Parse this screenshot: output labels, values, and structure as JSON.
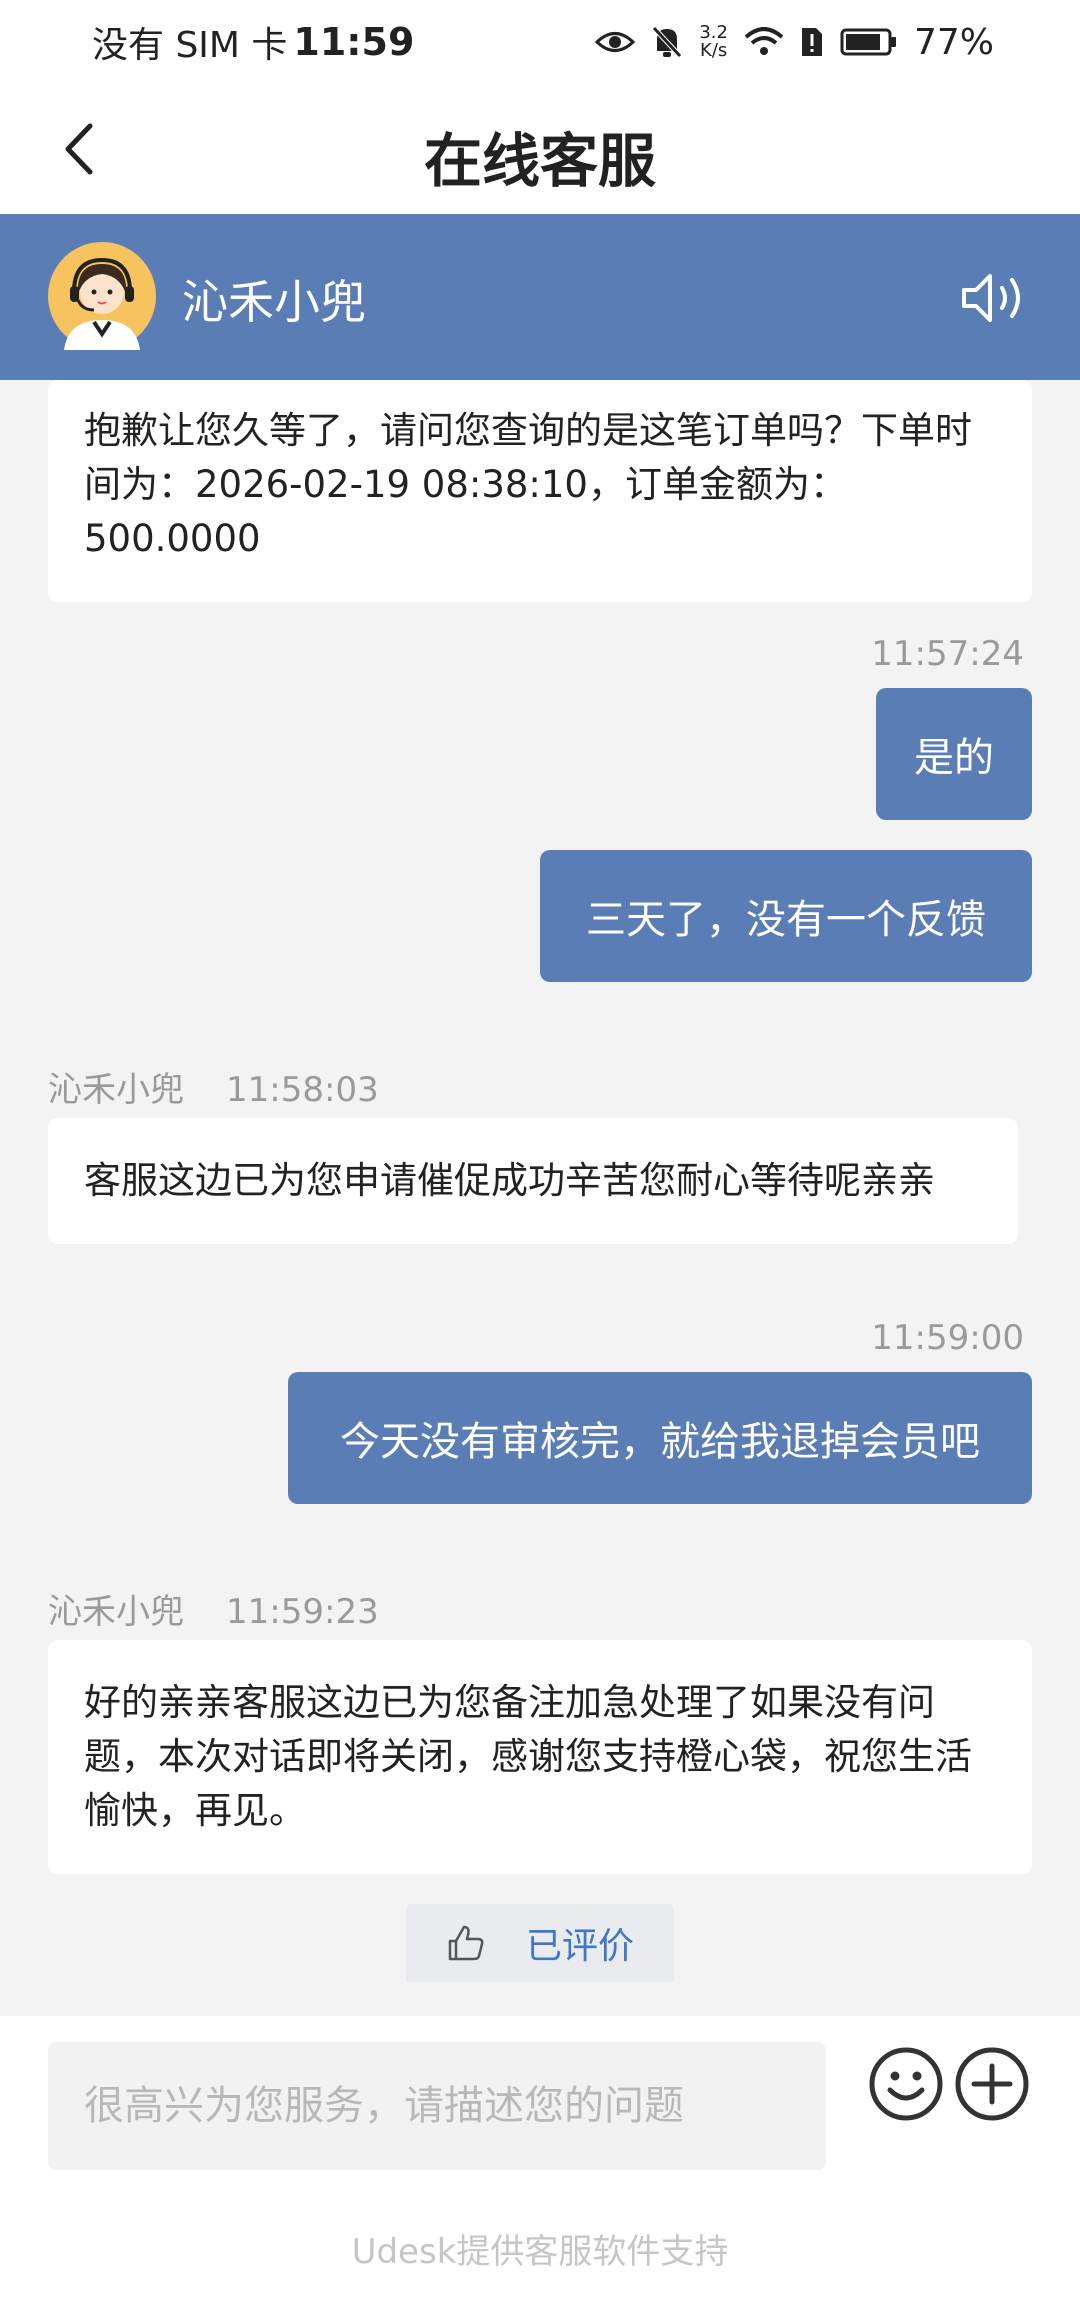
{
  "status_bar": {
    "carrier": "没有 SIM 卡",
    "time": "11:59",
    "net_speed_value": "3.2",
    "net_speed_unit": "K/s",
    "battery": "77%"
  },
  "header": {
    "title": "在线客服",
    "back_icon": "chevron-left-icon"
  },
  "agent": {
    "name": "沁禾小兜",
    "avatar_icon": "customer-service-avatar",
    "speaker_icon": "speaker-icon"
  },
  "messages": [
    {
      "from": "agent",
      "text": "抱歉让您久等了，请问您查询的是这笔订单吗？下单时间为：2026-02-19 08:38:10，订单金额为：500.0000"
    },
    {
      "from": "user",
      "time": "11:57:24",
      "text": "是的"
    },
    {
      "from": "user",
      "text": "三天了，没有一个反馈"
    },
    {
      "from": "agent",
      "name": "沁禾小兜",
      "time": "11:58:03",
      "text": "客服这边已为您申请催促成功辛苦您耐心等待呢亲亲"
    },
    {
      "from": "user",
      "time": "11:59:00",
      "text": "今天没有审核完，就给我退掉会员吧"
    },
    {
      "from": "agent",
      "name": "沁禾小兜",
      "time": "11:59:23",
      "text": "好的亲亲客服这边已为您备注加急处理了如果没有问题，本次对话即将关闭，感谢您支持橙心袋，祝您生活愉快，再见。"
    }
  ],
  "rating": {
    "label": "已评价",
    "icon": "thumbs-up-icon"
  },
  "input": {
    "placeholder": "很高兴为您服务，请描述您的问题",
    "value": ""
  },
  "footer": {
    "powered_by": "Udesk提供客服软件支持"
  },
  "colors": {
    "accent": "#5b7db6",
    "link": "#3f78c8",
    "background": "#f3f3f4"
  }
}
